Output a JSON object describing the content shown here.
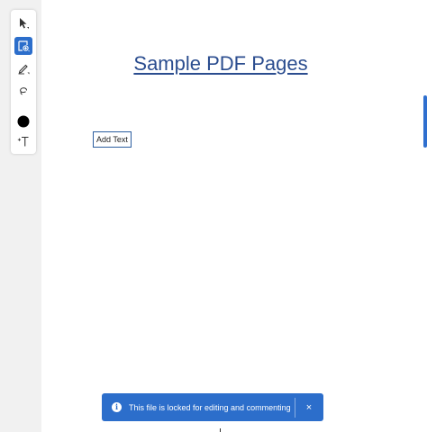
{
  "document": {
    "title": "Sample PDF Pages",
    "text_box_label": "Add Text"
  },
  "toolbar": {
    "tools": [
      {
        "name": "select-tool",
        "icon": "cursor-arrow-icon"
      },
      {
        "name": "comment-tool",
        "icon": "add-comment-icon",
        "active": true
      },
      {
        "name": "draw-tool",
        "icon": "pen-icon"
      },
      {
        "name": "lasso-tool",
        "icon": "lasso-icon"
      },
      {
        "name": "color-tool",
        "icon": "color-circle-icon"
      },
      {
        "name": "text-size-tool",
        "icon": "text-size-icon"
      }
    ],
    "active_color": "#2c6ecb",
    "current_ink_color": "#000000"
  },
  "notification": {
    "message": "This file is locked for editing and commenting",
    "close_label": "×",
    "background_color": "#2c6ecb"
  }
}
